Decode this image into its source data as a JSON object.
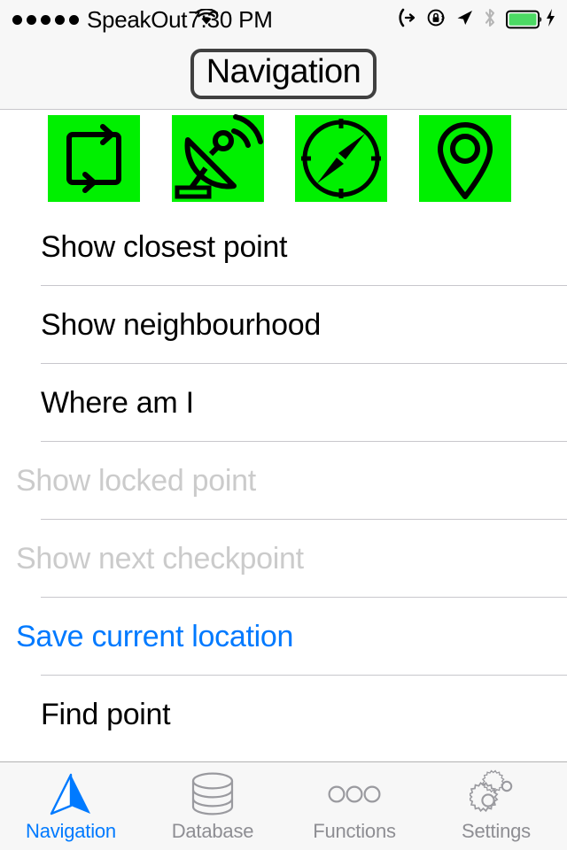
{
  "status_bar": {
    "signal_dots": 5,
    "carrier": "SpeakOut",
    "wifi_icon": "wifi-icon",
    "time": "7:30 PM",
    "right_icons": [
      "call-forwarding-icon",
      "rotation-lock-icon",
      "location-arrow-icon",
      "bluetooth-icon",
      "battery-icon",
      "charging-bolt-icon"
    ],
    "battery_color": "#4cd964"
  },
  "navbar": {
    "title": "Navigation"
  },
  "icon_strip": {
    "tile_color": "#00f000",
    "tiles": [
      {
        "name": "refresh-sync-icon"
      },
      {
        "name": "satellite-dish-icon"
      },
      {
        "name": "compass-icon"
      },
      {
        "name": "map-pin-icon"
      }
    ]
  },
  "list": {
    "rows": [
      {
        "label": "Show closest point",
        "state": "enabled",
        "indent": "indent"
      },
      {
        "label": "Show neighbourhood",
        "state": "enabled",
        "indent": "indent"
      },
      {
        "label": "Where am I",
        "state": "enabled",
        "indent": "indent"
      },
      {
        "label": "Show locked point",
        "state": "disabled",
        "indent": "flush"
      },
      {
        "label": "Show next checkpoint",
        "state": "disabled",
        "indent": "flush"
      },
      {
        "label": "Save current location",
        "state": "link",
        "indent": "flush"
      },
      {
        "label": "Find point",
        "state": "enabled",
        "indent": "indent"
      }
    ],
    "accent_color": "#007aff",
    "disabled_color": "#cbcbcb"
  },
  "tabbar": {
    "tabs": [
      {
        "label": "Navigation",
        "icon": "navigation-arrow-icon",
        "active": true
      },
      {
        "label": "Database",
        "icon": "database-cylinder-icon",
        "active": false
      },
      {
        "label": "Functions",
        "icon": "three-circles-icon",
        "active": false
      },
      {
        "label": "Settings",
        "icon": "gears-icon",
        "active": false
      }
    ],
    "active_color": "#007aff",
    "inactive_color": "#8e8e93"
  }
}
